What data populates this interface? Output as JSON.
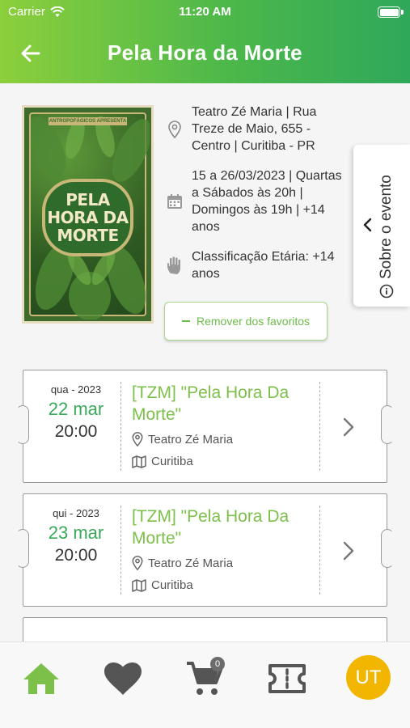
{
  "status_bar": {
    "carrier": "Carrier",
    "time": "11:20 AM"
  },
  "header": {
    "title": "Pela Hora da Morte"
  },
  "event": {
    "poster": {
      "top_text": "ANTROPOFÁGICOS APRESENTA",
      "title": "PELA HORA DA MORTE"
    },
    "location": "Teatro Zé Maria | Rua Treze de Maio, 655 - Centro | Curitiba - PR",
    "schedule": "15 a 26/03/2023 | Quartas a Sábados às 20h | Domingos às 19h | +14 anos",
    "rating": "Classificação Etária: +14 anos",
    "favorite_button": "Remover dos favoritos",
    "about_tab": "Sobre o evento"
  },
  "sessions": [
    {
      "week": "qua - 2023",
      "day": "22 mar",
      "time": "20:00",
      "title": "[TZM] \"Pela Hora Da Morte\"",
      "venue": "Teatro Zé Maria",
      "city": "Curitiba"
    },
    {
      "week": "qui - 2023",
      "day": "23 mar",
      "time": "20:00",
      "title": "[TZM] \"Pela Hora Da Morte\"",
      "venue": "Teatro Zé Maria",
      "city": "Curitiba"
    }
  ],
  "tab_bar": {
    "cart_count": "0",
    "avatar_initials": "UT"
  },
  "colors": {
    "accent_green": "#3aa85a",
    "title_green": "#7cc04a",
    "avatar_yellow": "#f2b600"
  }
}
